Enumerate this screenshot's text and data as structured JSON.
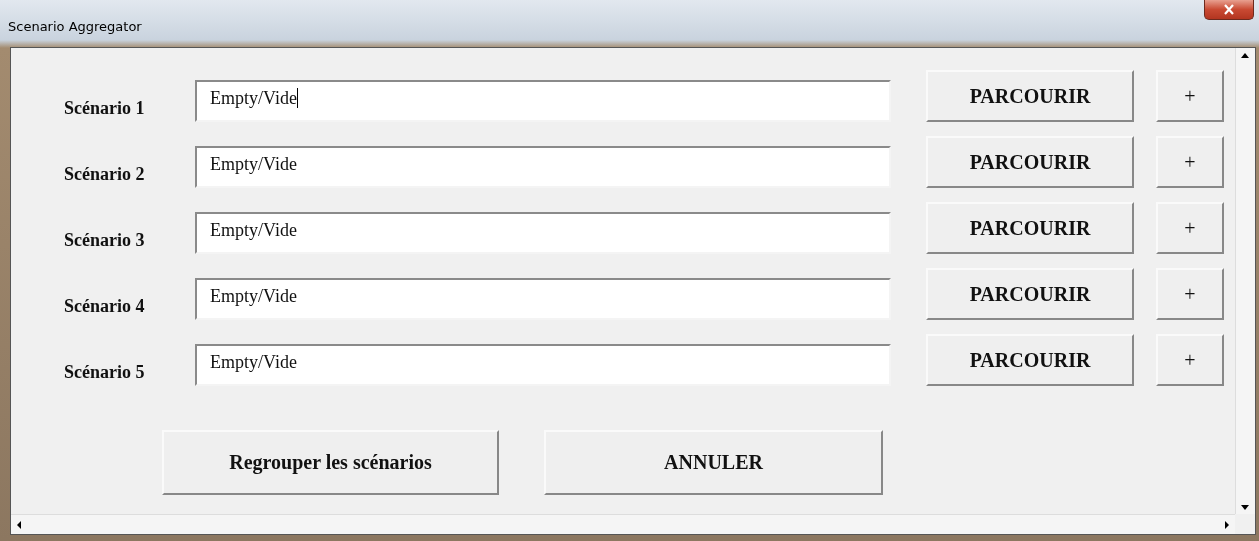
{
  "window": {
    "title": "Scenario Aggregator"
  },
  "scenarios": [
    {
      "label": "Scénario 1",
      "value": "Empty/Vide",
      "focused": true,
      "browse": "PARCOURIR",
      "add": "+"
    },
    {
      "label": "Scénario 2",
      "value": "Empty/Vide",
      "focused": false,
      "browse": "PARCOURIR",
      "add": "+"
    },
    {
      "label": "Scénario 3",
      "value": "Empty/Vide",
      "focused": false,
      "browse": "PARCOURIR",
      "add": "+"
    },
    {
      "label": "Scénario 4",
      "value": "Empty/Vide",
      "focused": false,
      "browse": "PARCOURIR",
      "add": "+"
    },
    {
      "label": "Scénario 5",
      "value": "Empty/Vide",
      "focused": false,
      "browse": "PARCOURIR",
      "add": "+"
    }
  ],
  "buttons": [
    "Regrouper les scénarios",
    "ANNULER"
  ]
}
